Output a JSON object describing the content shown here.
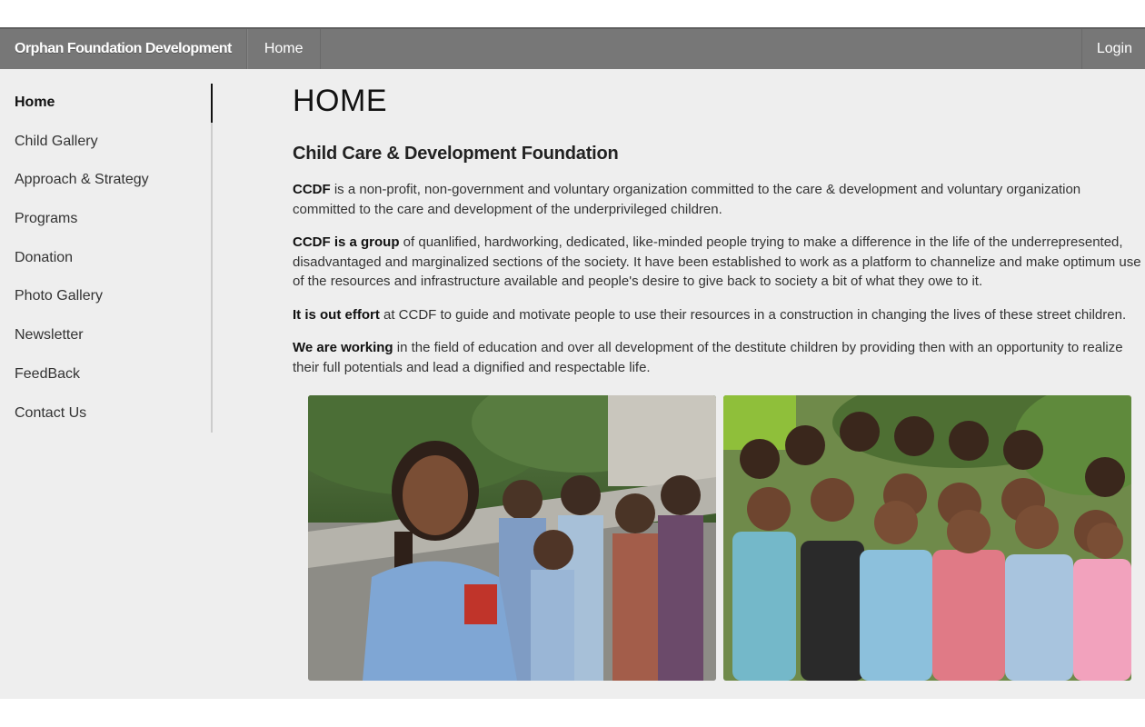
{
  "navbar": {
    "brand": "Orphan Foundation Development",
    "home": "Home",
    "login": "Login"
  },
  "sidebar": {
    "items": [
      {
        "label": "Home",
        "active": true
      },
      {
        "label": "Child Gallery"
      },
      {
        "label": "Approach & Strategy"
      },
      {
        "label": "Programs"
      },
      {
        "label": "Donation"
      },
      {
        "label": "Photo Gallery"
      },
      {
        "label": "Newsletter"
      },
      {
        "label": "FeedBack"
      },
      {
        "label": "Contact Us"
      }
    ]
  },
  "main": {
    "title": "HOME",
    "subtitle": "Child Care & Development Foundation",
    "paragraphs": [
      {
        "lead": "CCDF",
        "text": " is a non-profit, non-government and voluntary organization committed to the care & development and voluntary organization committed to the care and development of the underprivileged children."
      },
      {
        "lead": "CCDF is a group",
        "text": " of quanlified, hardworking, dedicated, like-minded people trying to make a difference in the life of the underrepresented, disadvantaged and marginalized sections of the society. It have been established to work as a platform to channelize and make optimum use of the resources and infrastructure available and people's desire to give back to society a bit of what they owe to it."
      },
      {
        "lead": "It is out effort",
        "text": " at CCDF to guide and motivate people to use their resources in a construction in changing the lives of these street children."
      },
      {
        "lead": "We are working",
        "text": " in the field of education and over all development of the destitute children by providing then with an opportunity to realize their full potentials and lead a dignified and respectable life."
      }
    ]
  },
  "colors": {
    "navbar": "#777777",
    "page_bg": "#eeeeee",
    "sidebar_border": "#cccccc"
  }
}
